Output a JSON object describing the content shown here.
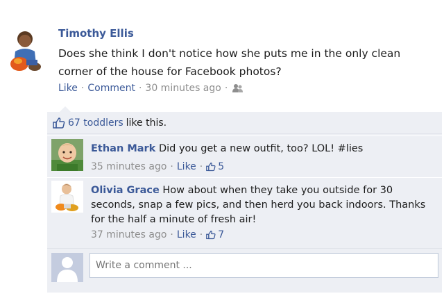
{
  "post": {
    "author": "Timothy Ellis",
    "text": "Does she think I don't notice how she puts me in the only clean corner of the house for Facebook photos?",
    "actions": {
      "like": "Like",
      "comment": "Comment",
      "time": "30 minutes ago",
      "privacy_icon": "friends-icon"
    }
  },
  "likes": {
    "count_text": "67 toddlers",
    "suffix": "like this."
  },
  "comments": [
    {
      "name": "Ethan Mark",
      "text": "Did you get a new outfit, too? LOL! #lies",
      "time": "35 minutes ago",
      "like": "Like",
      "like_count": "5"
    },
    {
      "name": "Olivia Grace",
      "text": "How about when they take you outside for 30 seconds, snap a few pics, and then herd you back indoors. Thanks for the half a minute of fresh air!",
      "time": "37 minutes ago",
      "like": "Like",
      "like_count": "7"
    }
  ],
  "composer": {
    "placeholder": "Write a comment ..."
  },
  "colors": {
    "link": "#3b5998",
    "muted": "#8e8e8e",
    "panel": "#edeff4"
  }
}
